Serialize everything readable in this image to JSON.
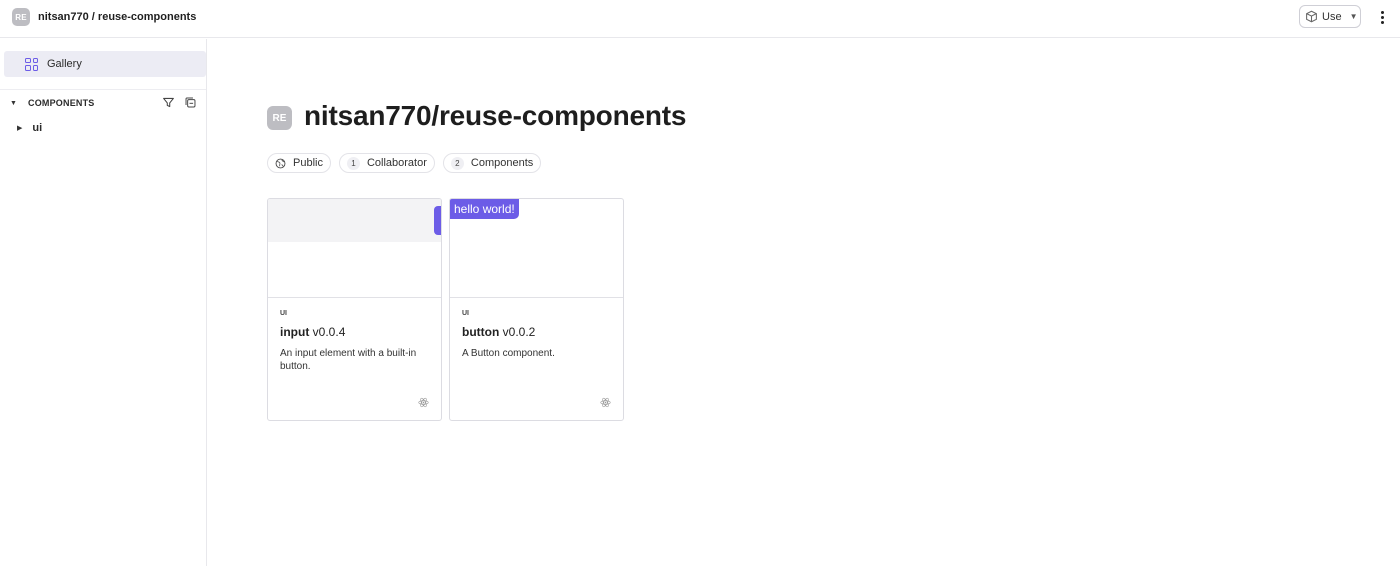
{
  "topbar": {
    "scope_badge": "RE",
    "title": "nitsan770 / reuse-components",
    "use_label": "Use",
    "use_icon": "cube-icon",
    "menu_icon": "kebab-menu-icon"
  },
  "sidebar": {
    "gallery_label": "Gallery",
    "components_header": "COMPONENTS",
    "tree": [
      {
        "label": "ui"
      }
    ]
  },
  "main": {
    "badge": "RE",
    "title": "nitsan770/reuse-components",
    "pills": [
      {
        "icon": "globe-icon",
        "count": "",
        "label": "Public"
      },
      {
        "icon": "",
        "count": "1",
        "label": "Collaborator"
      },
      {
        "icon": "",
        "count": "2",
        "label": "Components"
      }
    ],
    "cards": [
      {
        "scope": "UI",
        "name": "input",
        "version": "v0.0.4",
        "description": "An input element with a built-in button.",
        "preview_text": "",
        "env_icon": "react-icon"
      },
      {
        "scope": "UI",
        "name": "button",
        "version": "v0.0.2",
        "description": "A Button component.",
        "preview_text": "hello world!",
        "env_icon": "react-icon"
      }
    ]
  },
  "colors": {
    "accent": "#6c5ce7",
    "badge": "#bdbdc2",
    "selected_bg": "#ececf4"
  }
}
